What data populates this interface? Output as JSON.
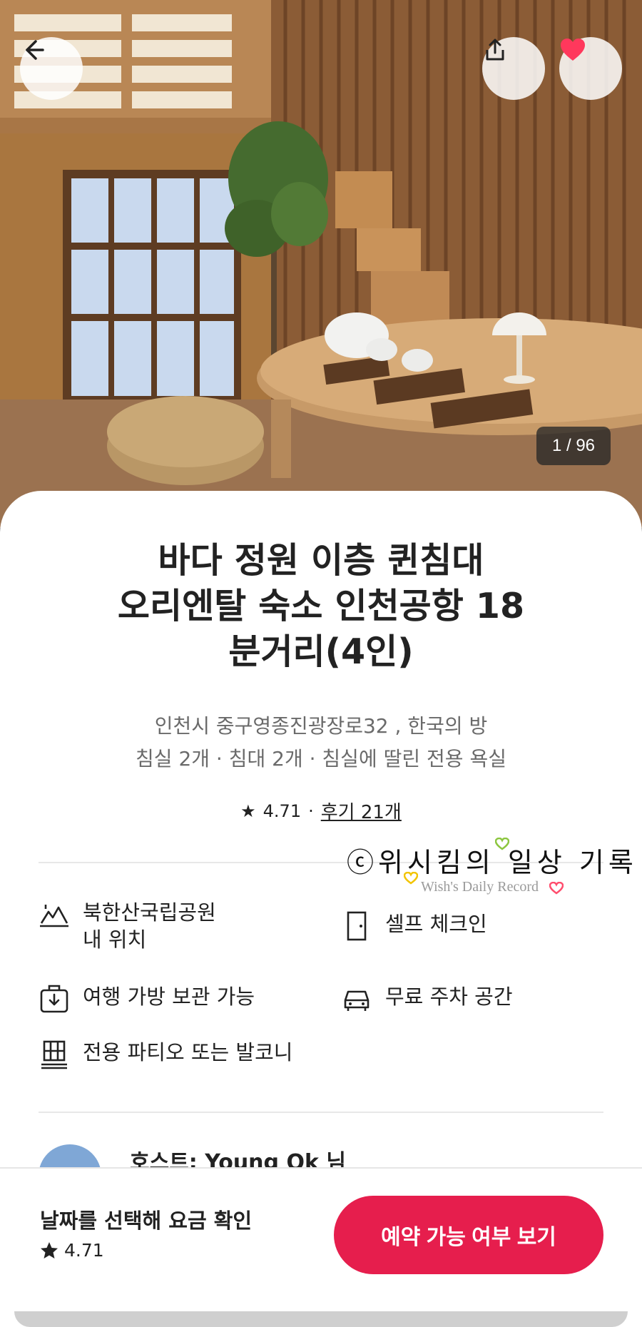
{
  "photo": {
    "counter": "1 / 96",
    "description_icon": "room-photo"
  },
  "header": {
    "back_icon": "arrow-left-icon",
    "share_icon": "share-icon",
    "favorite_icon": "heart-icon",
    "favorite_color": "#ff385c"
  },
  "listing": {
    "title_line1": "바다 정원 이층 퀸침대",
    "title_line2": "오리엔탈 숙소 인천공항 18",
    "title_line3": "분거리(4인)",
    "location": "인천시 중구영종진광장로32 , 한국의 방",
    "rooms": "침실 2개 · 침대 2개 · 침실에 딸린 전용 욕실",
    "rating": "4.71",
    "separator": "·",
    "reviews": "후기 21개"
  },
  "watermark": {
    "main": "ⓒ위시킴의 일상 기록",
    "sub": "Wish's Daily Record"
  },
  "amenities": [
    {
      "icon": "mountain-icon",
      "line1": "북한산국립공원",
      "line2": "내 위치"
    },
    {
      "icon": "door-icon",
      "line1": "셀프 체크인",
      "line2": ""
    },
    {
      "icon": "luggage-icon",
      "line1": "여행 가방 보관 가능",
      "line2": ""
    },
    {
      "icon": "car-icon",
      "line1": "무료 주차 공간",
      "line2": ""
    },
    {
      "icon": "patio-icon",
      "line1": "전용 파티오 또는 발코니",
      "line2": ""
    }
  ],
  "host": {
    "name": "호스트: Young Ok 님"
  },
  "bottom_bar": {
    "price_label": "날짜를 선택해 요금 확인",
    "rating": "4.71",
    "reserve_button": "예약 가능 여부 보기",
    "accent_color": "#e61e4d"
  }
}
